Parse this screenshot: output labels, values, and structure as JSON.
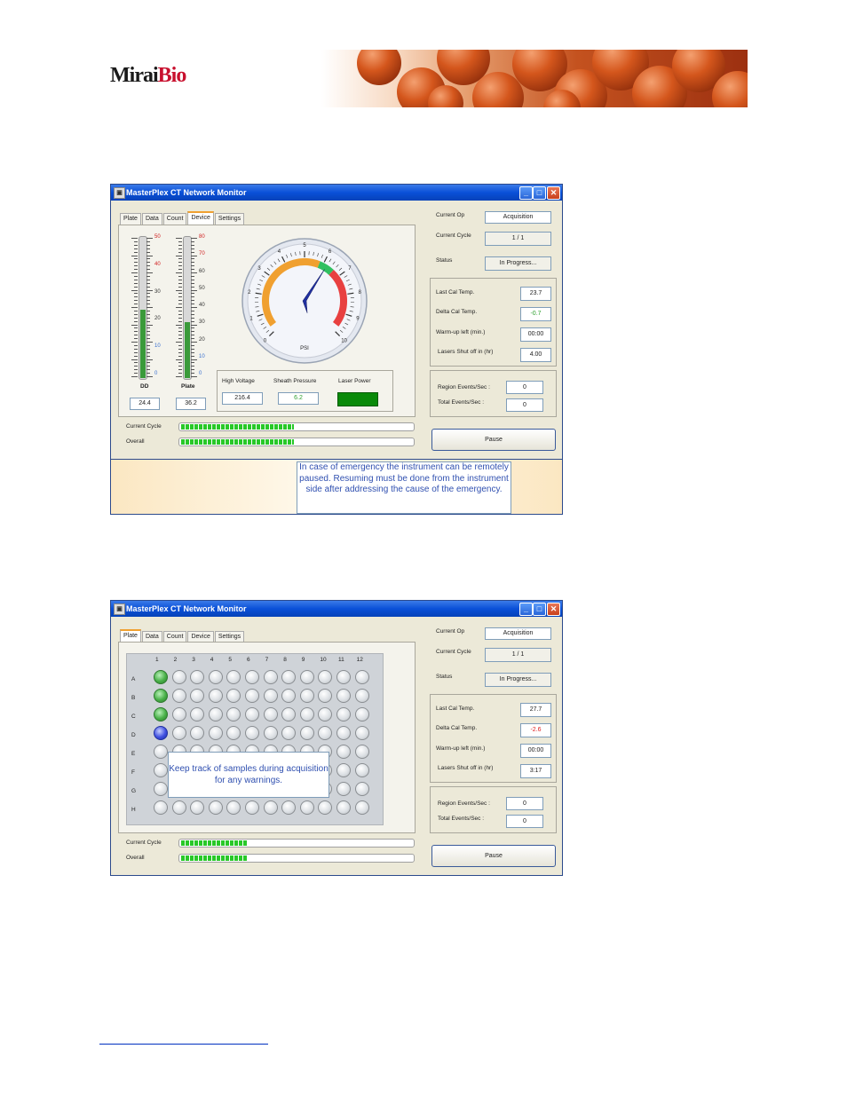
{
  "brand": {
    "logo_part1": "Mirai",
    "logo_part2": "Bio"
  },
  "window1": {
    "title": "MasterPlex CT Network Monitor",
    "tabs": [
      "Plate",
      "Data",
      "Count",
      "Device",
      "Settings"
    ],
    "active_tab": "Device",
    "thermometers": [
      {
        "label": "DD",
        "value": "24.4",
        "level_fraction": 0.49,
        "red_ticks": [
          "50",
          "40"
        ],
        "black_ticks": [
          "30",
          "20"
        ],
        "blue_ticks": [
          "10",
          "0"
        ]
      },
      {
        "label": "Plate",
        "value": "36.2",
        "level_fraction": 0.4,
        "red_ticks": [
          "80",
          "70"
        ],
        "black_ticks": [
          "60",
          "50",
          "40",
          "30",
          "20"
        ],
        "blue_ticks": [
          "10",
          "0"
        ]
      }
    ],
    "gauge": {
      "unit": "PSI",
      "ticks": [
        "0",
        "1",
        "2",
        "3",
        "4",
        "5",
        "6",
        "7",
        "8",
        "9",
        "10"
      ],
      "value": 6.2
    },
    "readouts": {
      "high_voltage_label": "High Voltage",
      "high_voltage_value": "216.4",
      "sheath_pressure_label": "Sheath Pressure",
      "sheath_pressure_value": "6.2",
      "laser_power_label": "Laser Power",
      "laser_power_value": "OK"
    },
    "status": {
      "current_op_label": "Current Op",
      "current_op_value": "Acquisition",
      "current_cycle_label": "Current Cycle",
      "current_cycle_value": "1 / 1",
      "status_label": "Status",
      "status_value": "In Progress..."
    },
    "temps": {
      "last_cal_label": "Last Cal Temp.",
      "last_cal_value": "23.7",
      "delta_cal_label": "Delta Cal Temp.",
      "delta_cal_value": "-0.7",
      "warmup_label": "Warm-up left (min.)",
      "warmup_value": "00:00",
      "lasers_label": "Lasers Shut off in (hr)",
      "lasers_value": "4.00"
    },
    "events": {
      "region_label": "Region Events/Sec :",
      "region_value": "0",
      "total_label": "Total Events/Sec :",
      "total_value": "0"
    },
    "progress": {
      "current_cycle_label": "Current Cycle",
      "current_cycle_fraction": 0.48,
      "overall_label": "Overall",
      "overall_fraction": 0.48
    },
    "pause_label": "Pause",
    "callout": "In case of emergency the instrument can be remotely paused. Resuming must be done from the instrument side after addressing the cause of the emergency."
  },
  "window2": {
    "title": "MasterPlex CT Network Monitor",
    "tabs": [
      "Plate",
      "Data",
      "Count",
      "Device",
      "Settings"
    ],
    "active_tab": "Plate",
    "columns": [
      "1",
      "2",
      "3",
      "4",
      "5",
      "6",
      "7",
      "8",
      "9",
      "10",
      "11",
      "12"
    ],
    "rows": [
      "A",
      "B",
      "C",
      "D",
      "E",
      "F",
      "G",
      "H"
    ],
    "well_states": {
      "A1": "done",
      "B1": "done",
      "C1": "done",
      "D1": "current"
    },
    "status": {
      "current_op_label": "Current Op",
      "current_op_value": "Acquisition",
      "current_cycle_label": "Current Cycle",
      "current_cycle_value": "1 / 1",
      "status_label": "Status",
      "status_value": "In Progress..."
    },
    "temps": {
      "last_cal_label": "Last Cal Temp.",
      "last_cal_value": "27.7",
      "delta_cal_label": "Delta Cal Temp.",
      "delta_cal_value": "-2.6",
      "warmup_label": "Warm-up left (min.)",
      "warmup_value": "00:00",
      "lasers_label": "Lasers Shut off in (hr)",
      "lasers_value": "3:17"
    },
    "events": {
      "region_label": "Region Events/Sec :",
      "region_value": "0",
      "total_label": "Total Events/Sec :",
      "total_value": "0"
    },
    "progress": {
      "current_cycle_label": "Current Cycle",
      "current_cycle_fraction": 0.28,
      "overall_label": "Overall",
      "overall_fraction": 0.28
    },
    "pause_label": "Pause",
    "callout": "Keep track of samples during acquisition for any warnings."
  },
  "colors": {
    "title_blue": "#0a50d8",
    "progress_green": "#28c828",
    "gauge_orange": "#f0a030",
    "gauge_red": "#e84040",
    "gauge_green": "#30c060"
  },
  "icons": [
    "app-icon",
    "minimize-icon",
    "maximize-icon",
    "close-icon"
  ]
}
